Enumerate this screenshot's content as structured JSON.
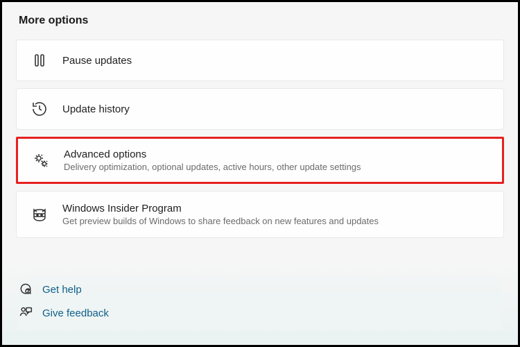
{
  "section_title": "More options",
  "options": {
    "pause": {
      "label": "Pause updates"
    },
    "history": {
      "label": "Update history"
    },
    "advanced": {
      "label": "Advanced options",
      "sub": "Delivery optimization, optional updates, active hours, other update settings"
    },
    "insider": {
      "label": "Windows Insider Program",
      "sub": "Get preview builds of Windows to share feedback on new features and updates"
    }
  },
  "footer": {
    "help": "Get help",
    "feedback": "Give feedback"
  }
}
